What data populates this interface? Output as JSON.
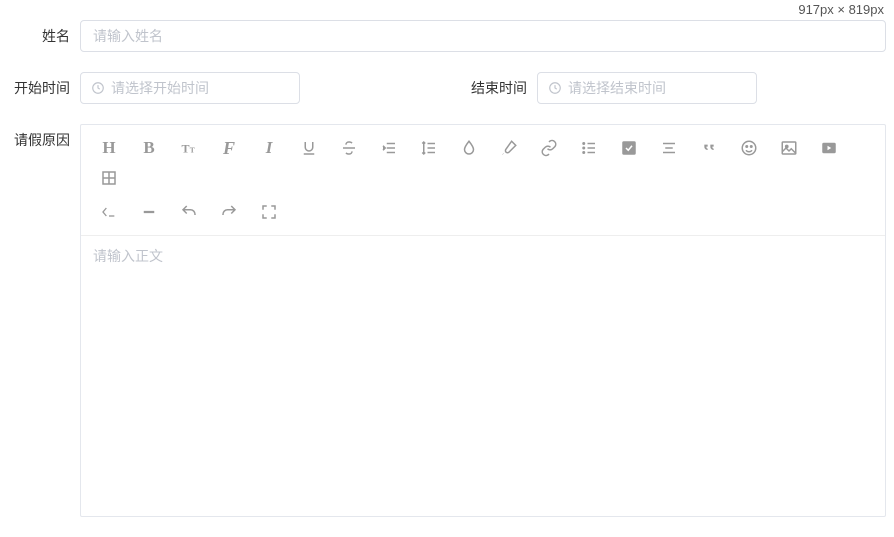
{
  "dimension_label": "917px × 819px",
  "fields": {
    "name": {
      "label": "姓名",
      "placeholder": "请输入姓名"
    },
    "start": {
      "label": "开始时间",
      "placeholder": "请选择开始时间"
    },
    "end": {
      "label": "结束时间",
      "placeholder": "请选择结束时间"
    },
    "reason": {
      "label": "请假原因",
      "placeholder": "请输入正文"
    }
  },
  "toolbar": {
    "row1": [
      {
        "name": "heading",
        "text": "H",
        "icon": "text"
      },
      {
        "name": "bold",
        "text": "B",
        "icon": "text"
      },
      {
        "name": "fontsize",
        "icon": "fontsize"
      },
      {
        "name": "fontfamily",
        "icon": "fontfamily"
      },
      {
        "name": "italic",
        "icon": "italic"
      },
      {
        "name": "underline",
        "icon": "underline"
      },
      {
        "name": "strikethrough",
        "icon": "strike"
      },
      {
        "name": "indent",
        "icon": "indent"
      },
      {
        "name": "lineheight",
        "icon": "lineheight"
      },
      {
        "name": "color",
        "icon": "color"
      },
      {
        "name": "highlight",
        "icon": "brush"
      },
      {
        "name": "link",
        "icon": "link"
      },
      {
        "name": "list",
        "icon": "list"
      },
      {
        "name": "todo",
        "icon": "todo"
      },
      {
        "name": "justify",
        "icon": "justify"
      },
      {
        "name": "quote",
        "icon": "quote"
      },
      {
        "name": "emoji",
        "icon": "emoji"
      },
      {
        "name": "image",
        "icon": "image"
      },
      {
        "name": "video",
        "icon": "video"
      },
      {
        "name": "table",
        "icon": "table"
      }
    ],
    "row2": [
      {
        "name": "code",
        "icon": "code"
      },
      {
        "name": "divider",
        "icon": "divider"
      },
      {
        "name": "undo",
        "icon": "undo"
      },
      {
        "name": "redo",
        "icon": "redo"
      },
      {
        "name": "fullscreen",
        "icon": "fullscreen"
      }
    ]
  }
}
